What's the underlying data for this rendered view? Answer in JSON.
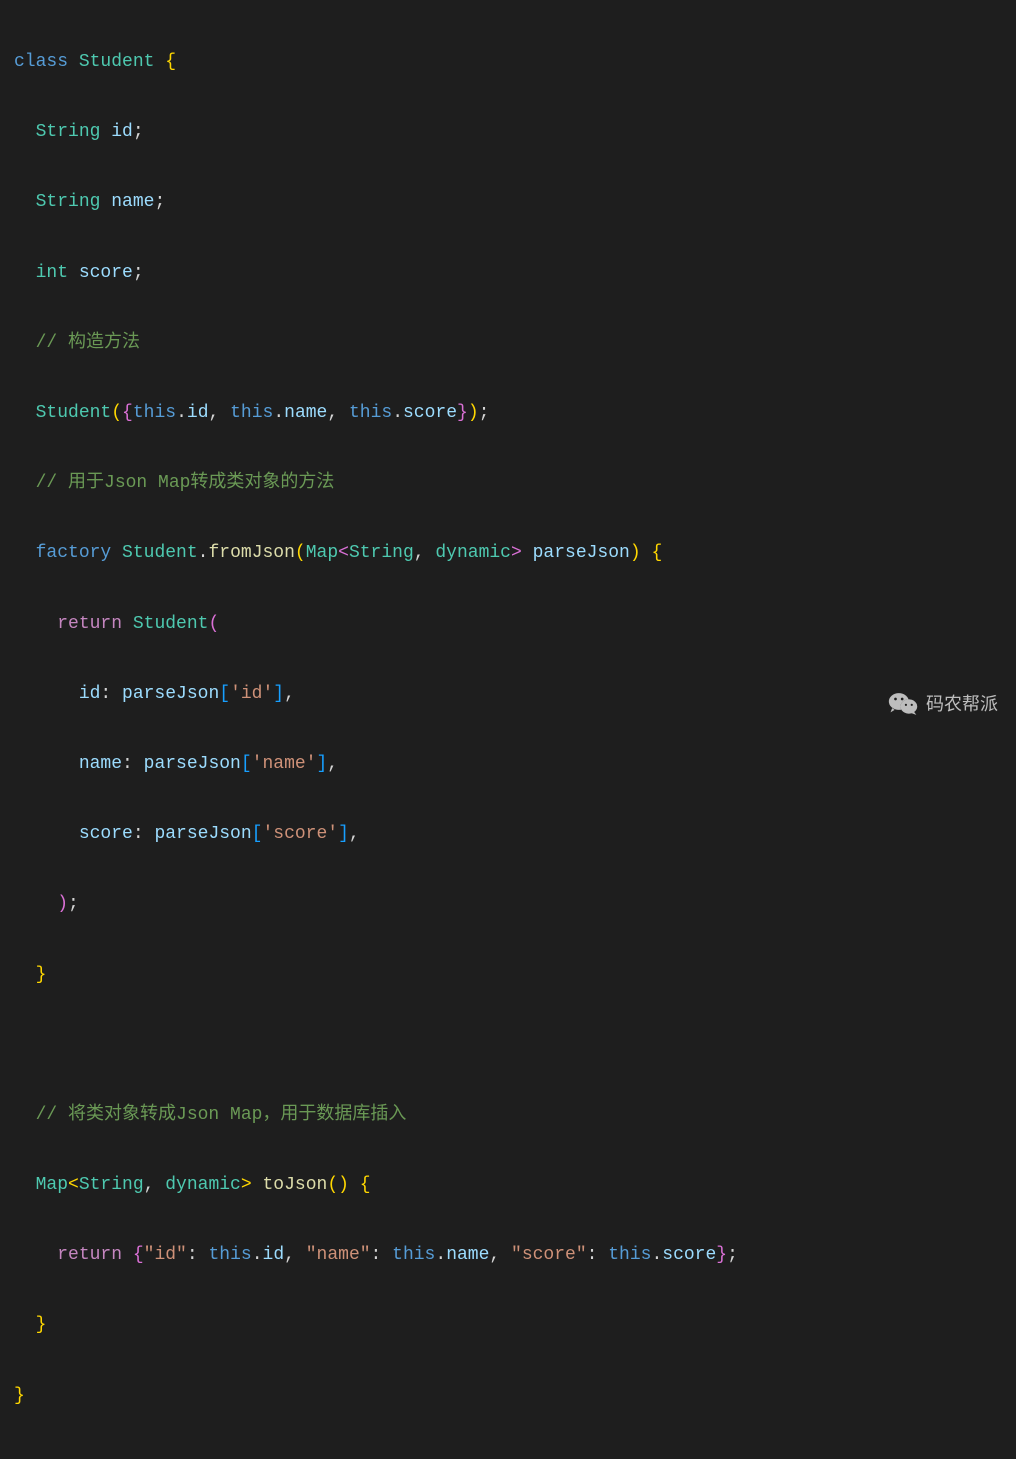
{
  "code": {
    "line1": {
      "kw": "class",
      "name": "Student",
      "brace": "{"
    },
    "line2": {
      "type": "String",
      "ident": "id",
      "semi": ";"
    },
    "line3": {
      "type": "String",
      "ident": "name",
      "semi": ";"
    },
    "line4": {
      "type": "int",
      "ident": "score",
      "semi": ";"
    },
    "line5": {
      "comment": "// 构造方法"
    },
    "line6": {
      "ctor": "Student",
      "p1": "id",
      "p2": "name",
      "p3": "score",
      "this": "this"
    },
    "line7": {
      "comment": "// 用于Json Map转成类对象的方法"
    },
    "line8": {
      "factory": "factory",
      "cls": "Student",
      "method": "fromJson",
      "maptype": "Map",
      "k": "String",
      "v": "dynamic",
      "param": "parseJson"
    },
    "line9": {
      "ret": "return",
      "cls": "Student"
    },
    "line10": {
      "key": "id",
      "param": "parseJson",
      "str": "'id'"
    },
    "line11": {
      "key": "name",
      "param": "parseJson",
      "str": "'name'"
    },
    "line12": {
      "key": "score",
      "param": "parseJson",
      "str": "'score'"
    },
    "line13": {
      "close": ");"
    },
    "line14": {
      "close": "}"
    },
    "line15_blank": "",
    "line16": {
      "comment": "// 将类对象转成Json Map，用于数据库插入"
    },
    "line17": {
      "maptype": "Map",
      "k": "String",
      "v": "dynamic",
      "method": "toJson"
    },
    "line18": {
      "ret": "return",
      "k1": "\"id\"",
      "k2": "\"name\"",
      "k3": "\"score\"",
      "this": "this",
      "p1": "id",
      "p2": "name",
      "p3": "score"
    },
    "line19": {
      "close": "}"
    },
    "line20": {
      "close": "}"
    }
  },
  "watermark": {
    "text": "码农帮派"
  }
}
